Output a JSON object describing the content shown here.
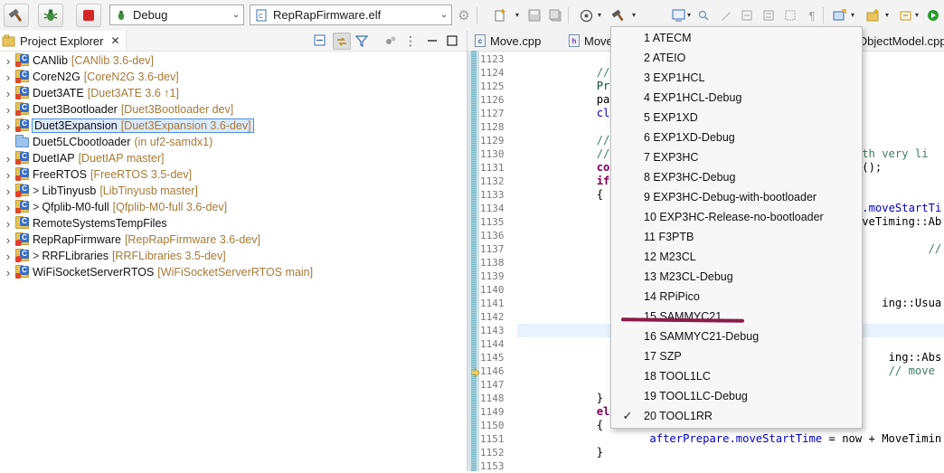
{
  "toolbar": {
    "config_combo": {
      "value": "Debug"
    },
    "target_combo": {
      "value": "RepRapFirmware.elf"
    },
    "icons": [
      "hammer-icon",
      "debug-bug-icon",
      "stop-icon",
      "gear-icon"
    ]
  },
  "project_explorer": {
    "title": "Project Explorer",
    "items": [
      {
        "name": "CANlib",
        "decoration": "[CANlib 3.6-dev]",
        "prefix": "",
        "type": "project",
        "selected": false
      },
      {
        "name": "CoreN2G",
        "decoration": "[CoreN2G 3.6-dev]",
        "prefix": "",
        "type": "project",
        "selected": false
      },
      {
        "name": "Duet3ATE",
        "decoration": "[Duet3ATE 3.6 ↑1]",
        "prefix": "",
        "type": "project",
        "selected": false
      },
      {
        "name": "Duet3Bootloader",
        "decoration": "[Duet3Bootloader dev]",
        "prefix": "",
        "type": "project",
        "selected": false
      },
      {
        "name": "Duet3Expansion",
        "decoration": "[Duet3Expansion 3.6-dev]",
        "prefix": "",
        "type": "project",
        "selected": true
      },
      {
        "name": "Duet5LCbootloader",
        "decoration": "(in uf2-samdx1)",
        "prefix": "",
        "type": "folder",
        "selected": false
      },
      {
        "name": "DuetIAP",
        "decoration": "[DuetIAP master]",
        "prefix": "",
        "type": "project",
        "selected": false
      },
      {
        "name": "FreeRTOS",
        "decoration": "[FreeRTOS 3.5-dev]",
        "prefix": "",
        "type": "project",
        "selected": false
      },
      {
        "name": "LibTinyusb",
        "decoration": "[LibTinyusb master]",
        "prefix": ">",
        "type": "project-error",
        "selected": false
      },
      {
        "name": "Qfplib-M0-full",
        "decoration": "[Qfplib-M0-full 3.6-dev]",
        "prefix": ">",
        "type": "project",
        "selected": false
      },
      {
        "name": "RemoteSystemsTempFiles",
        "decoration": "",
        "prefix": "",
        "type": "project-plain",
        "selected": false
      },
      {
        "name": "RepRapFirmware",
        "decoration": "[RepRapFirmware 3.6-dev]",
        "prefix": "",
        "type": "project-error",
        "selected": false
      },
      {
        "name": "RRFLibraries",
        "decoration": "[RRFLibraries 3.5-dev]",
        "prefix": ">",
        "type": "project-error",
        "selected": false
      },
      {
        "name": "WiFiSocketServerRTOS",
        "decoration": "[WiFiSocketServerRTOS main]",
        "prefix": "",
        "type": "project",
        "selected": false
      }
    ]
  },
  "editor": {
    "tabs": [
      {
        "label": "Move.cpp",
        "kind": "cpp"
      },
      {
        "label": "Move",
        "kind": "h"
      },
      {
        "label": "ObjectModel.cpp",
        "kind": "cpp"
      }
    ],
    "current_line": 1143,
    "debug_line": 1146,
    "line_numbers": [
      "1123",
      "1124",
      "1125",
      "1126",
      "1127",
      "1128",
      "1129",
      "1130",
      "1131",
      "1132",
      "1133",
      "1134",
      "1135",
      "1136",
      "1137",
      "1138",
      "1139",
      "1140",
      "1141",
      "1142",
      "1143",
      "1144",
      "1145",
      "1146",
      "1147",
      "1148",
      "1149",
      "1150",
      "1151",
      "1152",
      "1153"
    ],
    "code_lines": [
      [],
      [
        [
          "cm",
          "\t// Prepare "
        ]
      ],
      [
        [
          "id",
          "\tPrepParams "
        ]
      ],
      [
        [
          "txt",
          "\tparams.SetP"
        ]
      ],
      [
        [
          "fld",
          "\tclocksNeede"
        ]
      ],
      [],
      [
        [
          "cm",
          "\t// Decide w"
        ],
        [
          "pad",
          "                              "
        ],
        [
          "txt",
          ""
        ]
      ],
      [
        [
          "cm",
          "\t// Avoid se"
        ],
        [
          "pad",
          "                         "
        ],
        [
          "cm",
          "r with very li"
        ]
      ],
      [
        [
          "kw",
          "\tconst "
        ],
        [
          "txt",
          "uint"
        ],
        [
          "pad",
          "                           "
        ],
        [
          "it",
          "cks"
        ],
        [
          "txt",
          "();"
        ]
      ],
      [
        [
          "kw",
          "\tif "
        ],
        [
          "txt",
          "(prev->"
        ]
      ],
      [
        [
          "txt",
          "\t{"
        ]
      ],
      [
        [
          "kw",
          "\t\tconst "
        ],
        [
          "txt",
          "u"
        ],
        [
          "pad",
          "                        "
        ],
        [
          "fld",
          "e.moveStartTim"
        ]
      ],
      [
        [
          "kw",
          "\t\tif "
        ],
        [
          "txt",
          "((i"
        ],
        [
          "pad",
          "                         "
        ],
        [
          "txt",
          "oveTiming::Abs"
        ]
      ],
      [
        [
          "txt",
          "\t\t{"
        ]
      ],
      [
        [
          "fld",
          "\t\t\taft"
        ],
        [
          "pad",
          "                               "
        ],
        [
          "cm",
          "// star"
        ]
      ],
      [
        [
          "txt",
          "\t\t}"
        ]
      ],
      [
        [
          "kw",
          "\t\telse "
        ],
        [
          "txt",
          "i"
        ]
      ],
      [
        [
          "txt",
          "\t\t{"
        ]
      ],
      [
        [
          "fld",
          "\t\t\taft"
        ],
        [
          "pad",
          "                        "
        ],
        [
          "txt",
          "ing::UsualMin"
        ]
      ],
      [
        [
          "txt",
          "\t\t}"
        ]
      ],
      [
        [
          "kw",
          "\t\telse"
        ]
      ],
      [
        [
          "txt",
          "\t\t{"
        ]
      ],
      [
        [
          "fld",
          "\t\t\taf"
        ],
        [
          "pad",
          "                          "
        ],
        [
          "txt",
          "ing::AbsoluteM"
        ]
      ],
      [
        [
          "txt",
          "\t\t\trep"
        ],
        [
          "pad",
          "                         "
        ],
        [
          "cm",
          "// move was "
        ]
      ],
      [
        [
          "txt",
          "\t\t}"
        ]
      ],
      [
        [
          "txt",
          "\t}"
        ]
      ],
      [
        [
          "kw",
          "\telse"
        ]
      ],
      [
        [
          "txt",
          "\t{"
        ]
      ],
      [
        [
          "fld",
          "\t\tafterPrepare.moveStartTime"
        ],
        [
          "txt",
          " = now + MoveTiming::UsualMinimumP"
        ]
      ],
      [
        [
          "txt",
          "\t}"
        ]
      ],
      []
    ]
  },
  "build_config_menu": {
    "items": [
      {
        "label": "1 ATECM",
        "checked": false
      },
      {
        "label": "2 ATEIO",
        "checked": false
      },
      {
        "label": "3 EXP1HCL",
        "checked": false
      },
      {
        "label": "4 EXP1HCL-Debug",
        "checked": false
      },
      {
        "label": "5 EXP1XD",
        "checked": false
      },
      {
        "label": "6 EXP1XD-Debug",
        "checked": false
      },
      {
        "label": "7 EXP3HC",
        "checked": false
      },
      {
        "label": "8 EXP3HC-Debug",
        "checked": false
      },
      {
        "label": "9 EXP3HC-Debug-with-bootloader",
        "checked": false
      },
      {
        "label": "10 EXP3HC-Release-no-bootloader",
        "checked": false
      },
      {
        "label": "11 F3PTB",
        "checked": false
      },
      {
        "label": "12 M23CL",
        "checked": false
      },
      {
        "label": "13 M23CL-Debug",
        "checked": false
      },
      {
        "label": "14 RPiPico",
        "checked": false
      },
      {
        "label": "15 SAMMYC21",
        "checked": false
      },
      {
        "label": "16 SAMMYC21-Debug",
        "checked": false
      },
      {
        "label": "17 SZP",
        "checked": false
      },
      {
        "label": "18 TOOL1LC",
        "checked": false
      },
      {
        "label": "19 TOOL1LC-Debug",
        "checked": false
      },
      {
        "label": "20 TOOL1RR",
        "checked": true
      }
    ],
    "check_glyph": "✓",
    "annotation_color": "#8b1a4a"
  }
}
